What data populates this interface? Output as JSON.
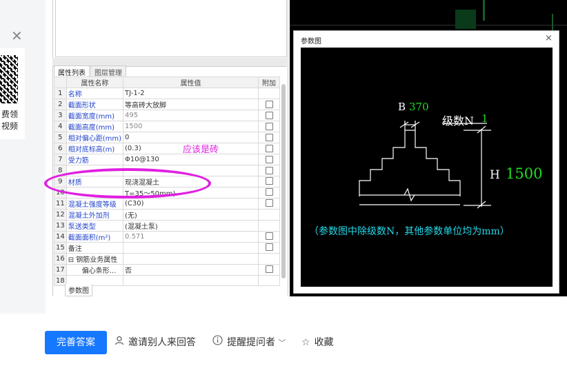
{
  "left": {
    "promo_lines": [
      "费领",
      "视频"
    ]
  },
  "panel": {
    "tabs": [
      {
        "label": "属性列表",
        "active": true
      },
      {
        "label": "图层管理",
        "active": false
      }
    ],
    "columns": [
      "属性名称",
      "属性值",
      "附加"
    ],
    "rows": [
      {
        "n": "1",
        "name": "名称",
        "value": "TJ-1-2",
        "check": false,
        "value_gray": false
      },
      {
        "n": "2",
        "name": "截面形状",
        "value": "等高砖大放脚",
        "check": true,
        "value_gray": false
      },
      {
        "n": "3",
        "name": "截面宽度(mm)",
        "value": "495",
        "check": true,
        "value_gray": true
      },
      {
        "n": "4",
        "name": "截面高度(mm)",
        "value": "1500",
        "check": true,
        "value_gray": true
      },
      {
        "n": "5",
        "name": "相对偏心距(mm)",
        "value": "0",
        "check": true,
        "value_gray": false
      },
      {
        "n": "6",
        "name": "相对底标高(m)",
        "value": "(0.3)",
        "check": true,
        "value_gray": false
      },
      {
        "n": "7",
        "name": "受力筋",
        "value": "Φ10@130",
        "check": true,
        "value_gray": false
      },
      {
        "n": "8",
        "name": "",
        "value": "",
        "check": true,
        "value_gray": false
      },
      {
        "n": "9",
        "name": "材质",
        "value": "现浇混凝土",
        "check": true,
        "value_gray": false
      },
      {
        "n": "10",
        "name": "",
        "value": "T=35～50mm)",
        "check": true,
        "value_gray": false
      },
      {
        "n": "11",
        "name": "混凝土强度等级",
        "value": "(C30)",
        "check": true,
        "value_gray": false
      },
      {
        "n": "12",
        "name": "混凝土外加剂",
        "value": "(无)",
        "check": false,
        "value_gray": false
      },
      {
        "n": "13",
        "name": "泵送类型",
        "value": "(混凝土泵)",
        "check": false,
        "value_gray": false
      },
      {
        "n": "14",
        "name": "截面面积(m²)",
        "value": "0.571",
        "check": true,
        "value_gray": true
      },
      {
        "n": "15",
        "name": "备注",
        "value": "",
        "check": true,
        "value_gray": false,
        "plain": true
      },
      {
        "n": "16",
        "name": "⊟ 钢筋业务属性",
        "value": "",
        "check": false,
        "value_gray": false,
        "plain": true
      },
      {
        "n": "17",
        "name": "　　偏心条形...",
        "value": "否",
        "check": true,
        "value_gray": false,
        "plain": true
      },
      {
        "n": "18",
        "name": "",
        "value": "",
        "check": false,
        "value_gray": false
      }
    ],
    "bottom_tab": "参数图",
    "annotation": "应该是砖"
  },
  "dialog": {
    "title": "参数图",
    "close": "×",
    "labels": {
      "b": "B",
      "b_value": "370",
      "level": "级数N",
      "level_value": "1",
      "h": "H",
      "h_value": "1500",
      "note": "（参数图中除级数N，其他参数单位均为mm）"
    },
    "colors": {
      "value_green": "#22dd22",
      "note_cyan": "#22d8e8",
      "line_white": "#ffffff"
    }
  },
  "actions": {
    "primary": "完善答案",
    "invite": "邀请别人来回答",
    "remind": "提醒提问者",
    "favorite": "收藏"
  }
}
